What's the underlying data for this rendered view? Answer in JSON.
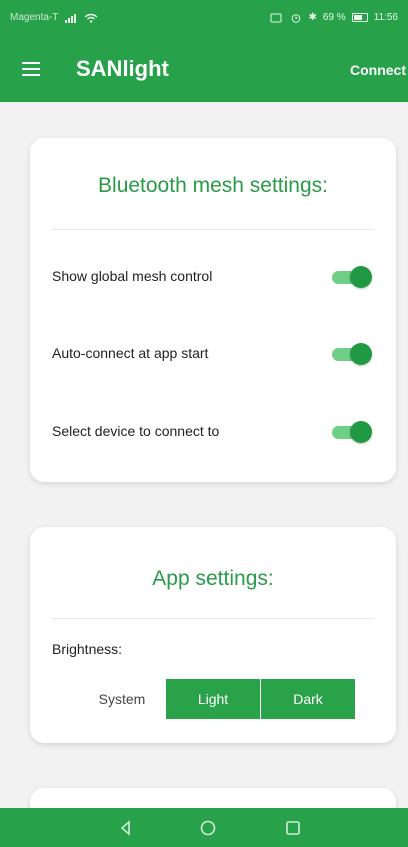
{
  "status_bar": {
    "carrier": "Magenta-T",
    "battery_percent": "69 %",
    "time": "11:56"
  },
  "app_bar": {
    "title": "SANlight",
    "connect_label": "Connect"
  },
  "bluetooth_card": {
    "title": "Bluetooth mesh settings:",
    "settings": [
      {
        "label": "Show global mesh control",
        "enabled": true
      },
      {
        "label": "Auto-connect at app start",
        "enabled": true
      },
      {
        "label": "Select device to connect to",
        "enabled": true
      }
    ]
  },
  "app_settings_card": {
    "title": "App settings:",
    "brightness_label": "Brightness:",
    "brightness_options": [
      "System",
      "Light",
      "Dark"
    ],
    "selected": "Light"
  },
  "nav_bar": {
    "icons": [
      "back-icon",
      "home-icon",
      "recent-apps-icon"
    ]
  },
  "colors": {
    "primary": "#27a24a",
    "toggle_track": "#6fcf86",
    "toggle_knob": "#1f9a42",
    "card_title": "#2a9b49"
  }
}
